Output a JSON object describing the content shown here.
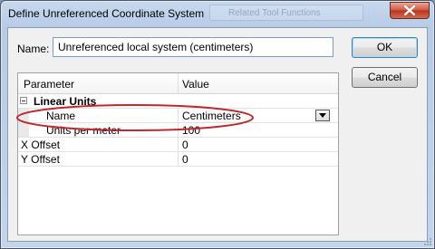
{
  "window": {
    "title": "Define Unreferenced Coordinate System",
    "background_hint": "Related Tool Functions",
    "close_icon": "close-icon"
  },
  "form": {
    "name_label": "Name:",
    "name_value": "Unreferenced local system (centimeters)"
  },
  "buttons": {
    "ok": "OK",
    "cancel": "Cancel"
  },
  "grid": {
    "headers": [
      "Parameter",
      "Value"
    ],
    "category": "Linear Units",
    "rows": [
      {
        "param": "Name",
        "value": "Centimeters"
      },
      {
        "param": "Units per meter",
        "value": "100"
      },
      {
        "param": "X Offset",
        "value": "0"
      },
      {
        "param": "Y Offset",
        "value": "0"
      }
    ]
  },
  "colors": {
    "annotation": "#c0282d",
    "title_bar": "#b6cbe6",
    "close_button": "#c9452c"
  }
}
